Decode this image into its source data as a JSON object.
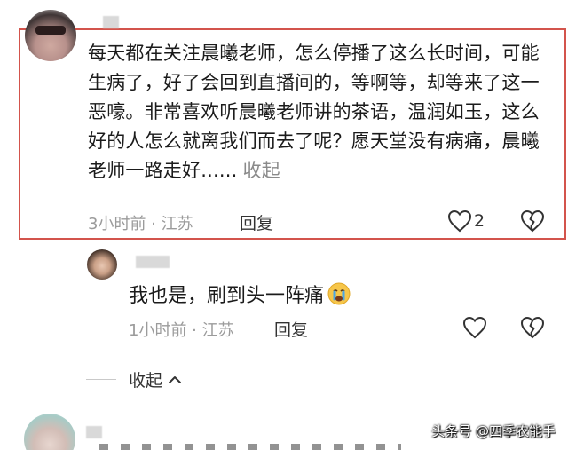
{
  "comment": {
    "text": "每天都在关注晨曦老师，怎么停播了这么长时间，可能生病了，好了会回到直播间的，等啊等，却等来了这一恶嚎。非常喜欢听晨曦老师讲的茶语，温润如玉，这么好的人怎么就离我们而去了呢？愿天堂没有病痛，晨曦老师一路走好......",
    "collapse_label": "收起",
    "meta": "3小时前 · 江苏",
    "reply_label": "回复",
    "like_count": "2"
  },
  "reply": {
    "text": "我也是，刷到头一阵痛",
    "meta": "1小时前 · 江苏",
    "reply_label": "回复"
  },
  "thread": {
    "collapse_label": "收起"
  },
  "watermark": "头条号 @四季农能手",
  "colors": {
    "highlight_border": "#d3544c",
    "meta_gray": "#9b9b9b"
  },
  "icons": [
    "heart-outline-icon",
    "broken-heart-icon",
    "crying-face-emoji",
    "chevron-up-icon"
  ]
}
